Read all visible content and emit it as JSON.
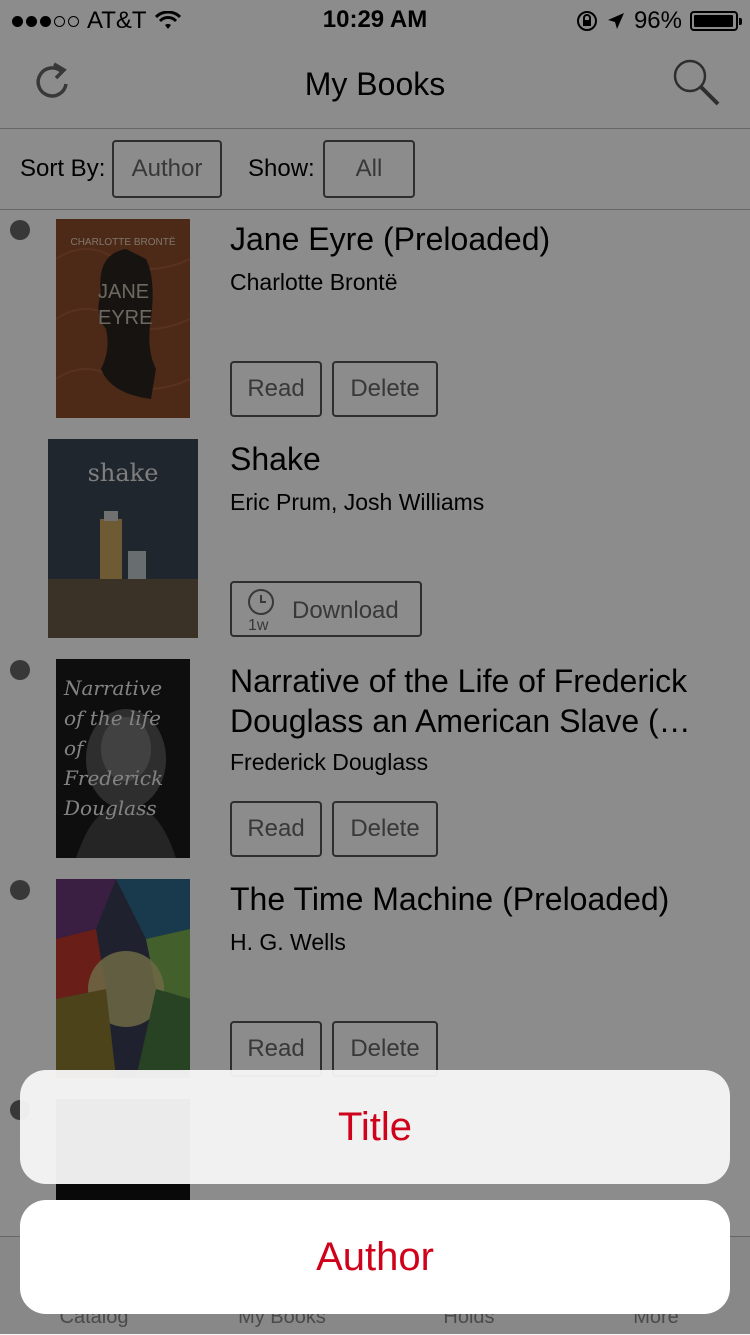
{
  "status": {
    "carrier": "AT&T",
    "time": "10:29 AM",
    "battery": "96%"
  },
  "nav": {
    "title": "My Books"
  },
  "sort": {
    "sort_label": "Sort By:",
    "sort_value": "Author",
    "show_label": "Show:",
    "show_value": "All"
  },
  "books": [
    {
      "title": "Jane Eyre (Preloaded)",
      "author": "Charlotte Brontë",
      "cover_text": "JANE EYRE",
      "cover_top": "CHARLOTTE BRONTË",
      "read": "Read",
      "delete": "Delete"
    },
    {
      "title": "Shake",
      "author": "Eric Prum, Josh Williams",
      "cover_text": "shake",
      "download": "Download",
      "download_badge": "1w"
    },
    {
      "title_line1": "Narrative of the Life of Frederick",
      "title_line2": "Douglass an American Slave (…",
      "author": "Frederick Douglass",
      "cover_text": "Narrative of the life of Frederick Douglass",
      "read": "Read",
      "delete": "Delete"
    },
    {
      "title": "The Time Machine (Preloaded)",
      "author": "H. G. Wells",
      "read": "Read",
      "delete": "Delete"
    }
  ],
  "tabs": [
    "Catalog",
    "My Books",
    "Holds",
    "More"
  ],
  "sheet": {
    "option1": "Title",
    "option2": "Author"
  },
  "colors": {
    "accent": "#d0021b"
  }
}
